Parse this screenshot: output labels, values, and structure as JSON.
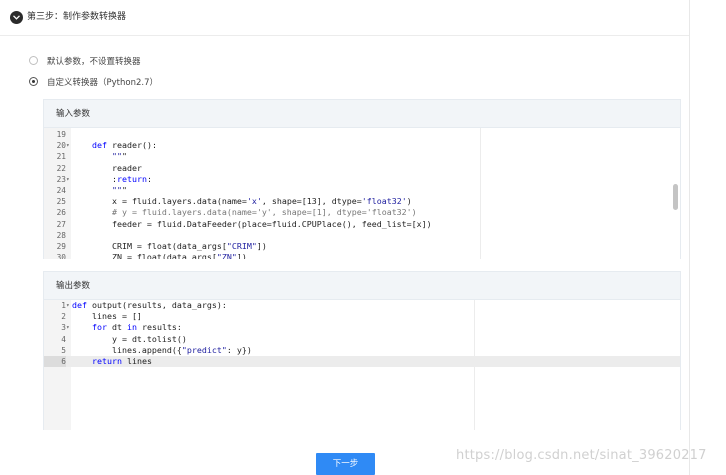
{
  "step": {
    "title": "第三步：制作参数转换器",
    "icon": "chevron-down-icon"
  },
  "options": [
    {
      "label": "默认参数，不设置转换器",
      "checked": false
    },
    {
      "label": "自定义转换器（Python2.7）",
      "checked": true
    }
  ],
  "input_panel": {
    "title": "输入参数",
    "lines": [
      {
        "num": "19",
        "fold": "",
        "code": ""
      },
      {
        "num": "20",
        "fold": "▾",
        "code": "    def reader():"
      },
      {
        "num": "21",
        "fold": "",
        "code": "        \"\"\""
      },
      {
        "num": "22",
        "fold": "",
        "code": "        reader"
      },
      {
        "num": "23",
        "fold": "▾",
        "code": "        :return:"
      },
      {
        "num": "24",
        "fold": "",
        "code": "        \"\"\""
      },
      {
        "num": "25",
        "fold": "",
        "code": "        x = fluid.layers.data(name='x', shape=[13], dtype='float32')"
      },
      {
        "num": "26",
        "fold": "",
        "code": "        # y = fluid.layers.data(name='y', shape=[1], dtype='float32')"
      },
      {
        "num": "27",
        "fold": "",
        "code": "        feeder = fluid.DataFeeder(place=fluid.CPUPlace(), feed_list=[x])"
      },
      {
        "num": "28",
        "fold": "",
        "code": ""
      },
      {
        "num": "29",
        "fold": "",
        "code": "        CRIM = float(data_args[\"CRIM\"])"
      },
      {
        "num": "30",
        "fold": "",
        "code": "        ZN = float(data_args[\"ZN\"])"
      }
    ]
  },
  "output_panel": {
    "title": "输出参数",
    "lines": [
      {
        "num": "1",
        "fold": "▾",
        "code": "def output(results, data_args):"
      },
      {
        "num": "2",
        "fold": "",
        "code": "    lines = []"
      },
      {
        "num": "3",
        "fold": "▾",
        "code": "    for dt in results:"
      },
      {
        "num": "4",
        "fold": "",
        "code": "        y = dt.tolist()"
      },
      {
        "num": "5",
        "fold": "",
        "code": "        lines.append({\"predict\": y})"
      },
      {
        "num": "6",
        "fold": "",
        "code": "    return lines"
      }
    ],
    "active_line": 5
  },
  "next_button": {
    "label": "下一步"
  },
  "watermark": "https://blog.csdn.net/sinat_39620217",
  "colors": {
    "accent": "#2f8af5",
    "panel_header": "#f2f5f8",
    "gutter": "#f4f4f4"
  }
}
